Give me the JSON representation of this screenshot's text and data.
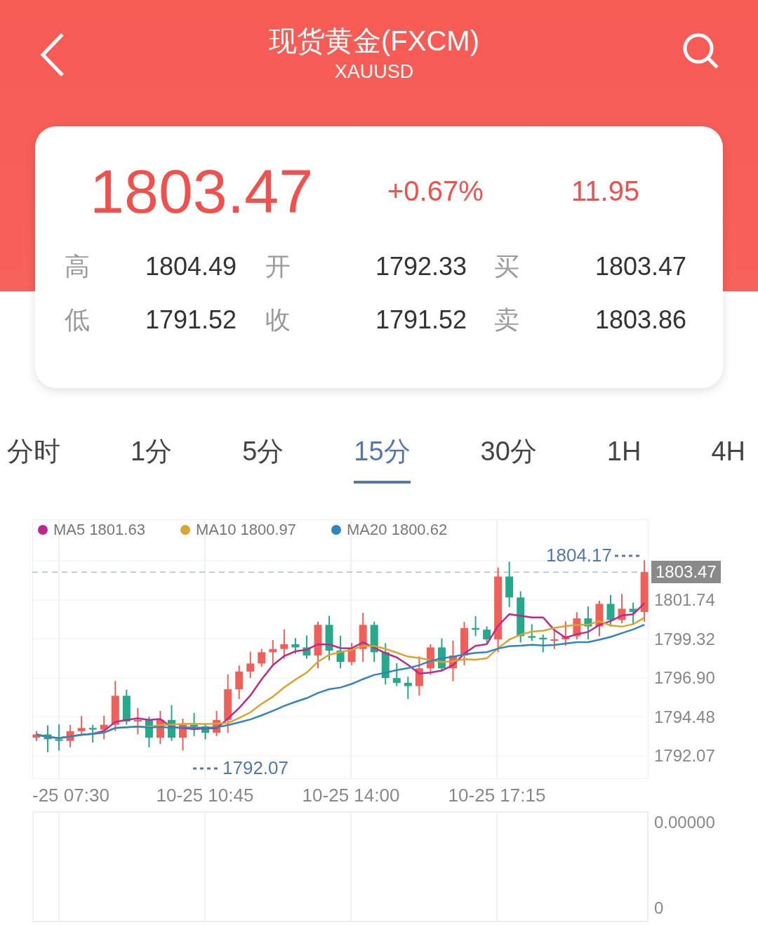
{
  "header": {
    "title": "现货黄金(FXCM)",
    "subtitle": "XAUUSD"
  },
  "quote": {
    "price": "1803.47",
    "change_percent": "+0.67%",
    "change": "11.95",
    "stats": [
      [
        {
          "label": "高",
          "value": "1804.49"
        },
        {
          "label": "开",
          "value": "1792.33"
        },
        {
          "label": "买",
          "value": "1803.47"
        }
      ],
      [
        {
          "label": "低",
          "value": "1791.52"
        },
        {
          "label": "收",
          "value": "1791.52"
        },
        {
          "label": "卖",
          "value": "1803.86"
        }
      ]
    ]
  },
  "tabs": [
    {
      "label": "分时",
      "selected": false
    },
    {
      "label": "1分",
      "selected": false
    },
    {
      "label": "5分",
      "selected": false
    },
    {
      "label": "15分",
      "selected": true
    },
    {
      "label": "30分",
      "selected": false
    },
    {
      "label": "1H",
      "selected": false
    },
    {
      "label": "4H",
      "selected": false
    }
  ],
  "chart": {
    "legend": [
      {
        "name": "MA5",
        "value": "1801.63",
        "color": "#c0288f"
      },
      {
        "name": "MA10",
        "value": "1800.97",
        "color": "#d9a52c"
      },
      {
        "name": "MA20",
        "value": "1800.62",
        "color": "#2e86c1"
      }
    ],
    "high_marker": "1804.17",
    "low_marker": "1792.07",
    "last_price": "1803.47",
    "y_ticks": [
      "1801.74",
      "1799.32",
      "1796.90",
      "1794.48",
      "1792.07"
    ],
    "x_ticks": [
      "-25 07:30",
      "10-25 10:45",
      "10-25 14:00",
      "10-25 17:15"
    ]
  },
  "volume_panel": {
    "y_ticks": [
      "0.00000",
      "0"
    ]
  }
}
